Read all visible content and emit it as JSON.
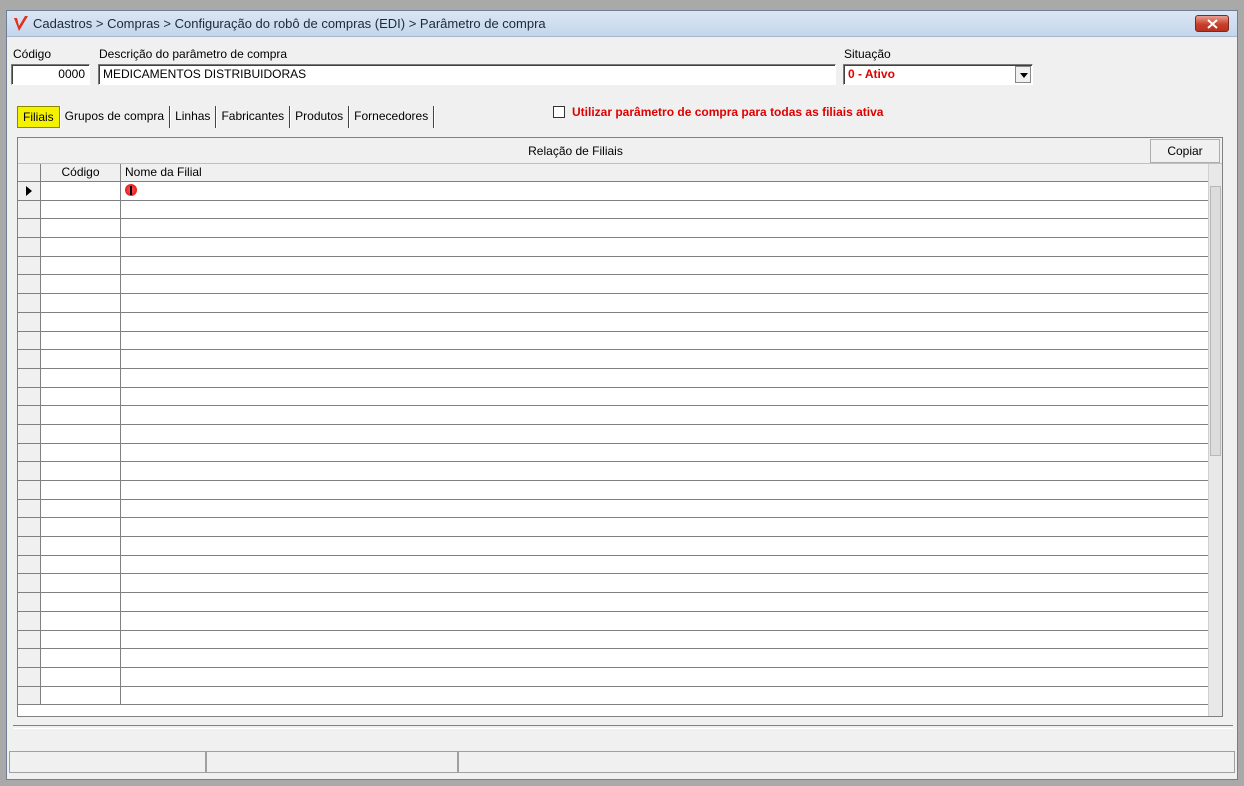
{
  "window": {
    "title": "Cadastros > Compras > Configuração do robô de compras (EDI) > Parâmetro de compra",
    "close_icon": "close-icon",
    "logo_color": "#e0301e"
  },
  "form": {
    "codigo_label": "Código",
    "codigo_value": "0000",
    "descricao_label": "Descrição do parâmetro de compra",
    "descricao_value": "MEDICAMENTOS DISTRIBUIDORAS",
    "situacao_label": "Situação",
    "situacao_value": "0 - Ativo"
  },
  "tabs": [
    {
      "label": "Filiais",
      "active": true
    },
    {
      "label": "Grupos de compra"
    },
    {
      "label": "Linhas"
    },
    {
      "label": "Fabricantes"
    },
    {
      "label": "Produtos"
    },
    {
      "label": "Fornecedores"
    }
  ],
  "option": {
    "label": "Utilizar parâmetro de compra para todas as filiais ativa",
    "checked": false
  },
  "panel": {
    "title": "Relação de Filiais",
    "copy_label": "Copiar",
    "columns": [
      "Código",
      "Nome da Filial"
    ]
  },
  "colors": {
    "active_tab": "#f5f200",
    "alert_text": "#e00000"
  }
}
